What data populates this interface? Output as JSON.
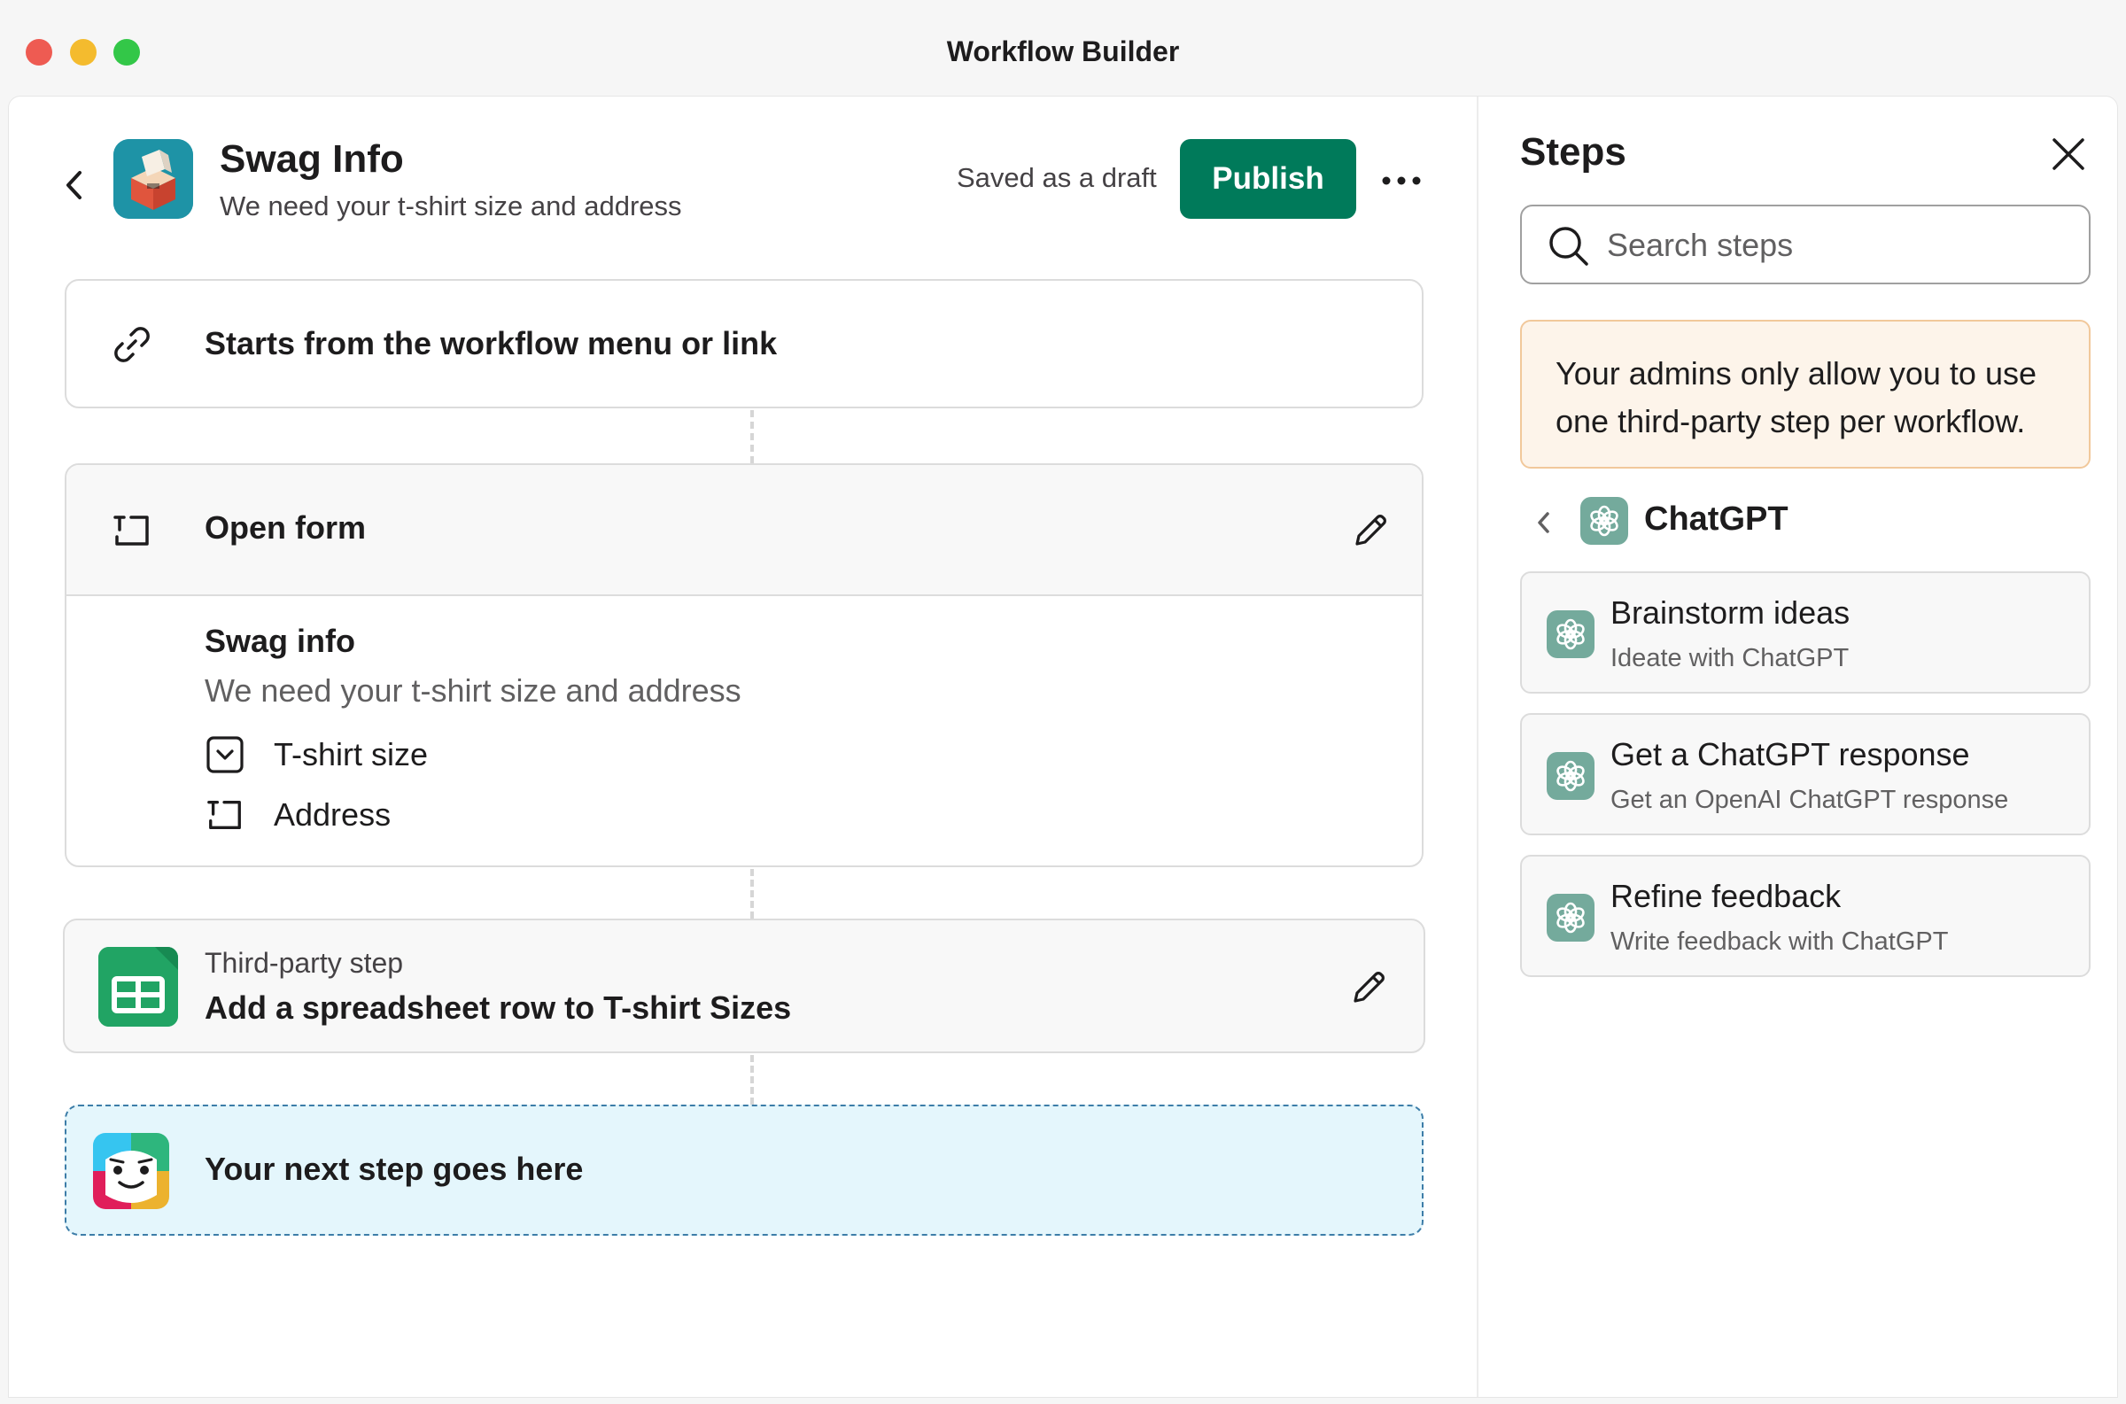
{
  "window": {
    "title": "Workflow Builder"
  },
  "header": {
    "title": "Swag Info",
    "subtitle": "We need your t-shirt size and address",
    "status": "Saved as a draft",
    "publish_label": "Publish"
  },
  "trigger": {
    "label": "Starts from the workflow menu or link"
  },
  "form_step": {
    "label": "Open form",
    "form_title": "Swag info",
    "form_description": "We need your t-shirt size and address",
    "fields": [
      {
        "label": "T-shirt size",
        "icon": "dropdown-field-icon"
      },
      {
        "label": "Address",
        "icon": "text-field-icon"
      }
    ]
  },
  "third_party_step": {
    "kicker": "Third-party step",
    "label": "Add a spreadsheet row to T-shirt Sizes"
  },
  "next_step": {
    "label": "Your next step goes here"
  },
  "steps_panel": {
    "title": "Steps",
    "search_placeholder": "Search steps",
    "notice": "Your admins only allow you to use one third-party step per workflow.",
    "provider": "ChatGPT",
    "items": [
      {
        "title": "Brainstorm ideas",
        "description": "Ideate with ChatGPT"
      },
      {
        "title": "Get a ChatGPT response",
        "description": "Get an OpenAI ChatGPT response"
      },
      {
        "title": "Refine feedback",
        "description": "Write feedback with ChatGPT"
      }
    ]
  },
  "colors": {
    "publish": "#007a5a",
    "notice_bg": "#fdf4ea",
    "notice_border": "#f1c89b",
    "next_step_bg": "#e4f6fc",
    "chatgpt": "#74aa9c",
    "sheets": "#21a464"
  }
}
